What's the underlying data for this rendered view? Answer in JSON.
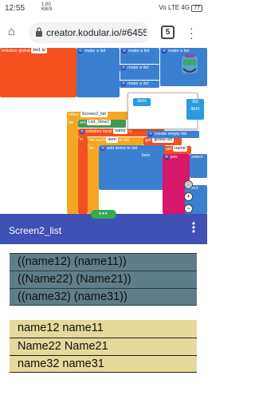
{
  "status_bar": {
    "time": "12:55",
    "speed_value": "1.00",
    "speed_unit": "KB/S",
    "network": "Vo LTE 4G",
    "battery": "77"
  },
  "browser": {
    "url": "creator.kodular.io/#6455",
    "tab_count": "5"
  },
  "editor": {
    "blocks": {
      "initialize_global": "initialize global",
      "list_to": "list1  to",
      "make_a_list": "make a list",
      "when": "when",
      "screen_event": "Screen2_list",
      "do": "do",
      "set": "set",
      "list_view": "List_View1",
      "init_local": "initialize local",
      "name_var": "name",
      "to": "to",
      "in": "in",
      "for_each": "for each",
      "item": "item",
      "in_list": "in list",
      "get": "get",
      "global_list": "global list",
      "add_items": "add items to list",
      "list_label": "list",
      "item_label": "item",
      "join": "join",
      "create_empty_list": "create empty list",
      "select": "select"
    }
  },
  "app": {
    "title": "Screen2_list"
  },
  "list1": {
    "items": [
      "((name12) (name11))",
      "((Name22) (Name21))",
      "((name32) (name31))"
    ]
  },
  "list2": {
    "items": [
      "name12 name11",
      "Name22 Name21",
      "name32 name31"
    ]
  },
  "colors": {
    "header": "#3f51b5",
    "list1_bg": "#5f7d88",
    "list2_bg": "#e5da9b",
    "handle": "#34a853"
  }
}
